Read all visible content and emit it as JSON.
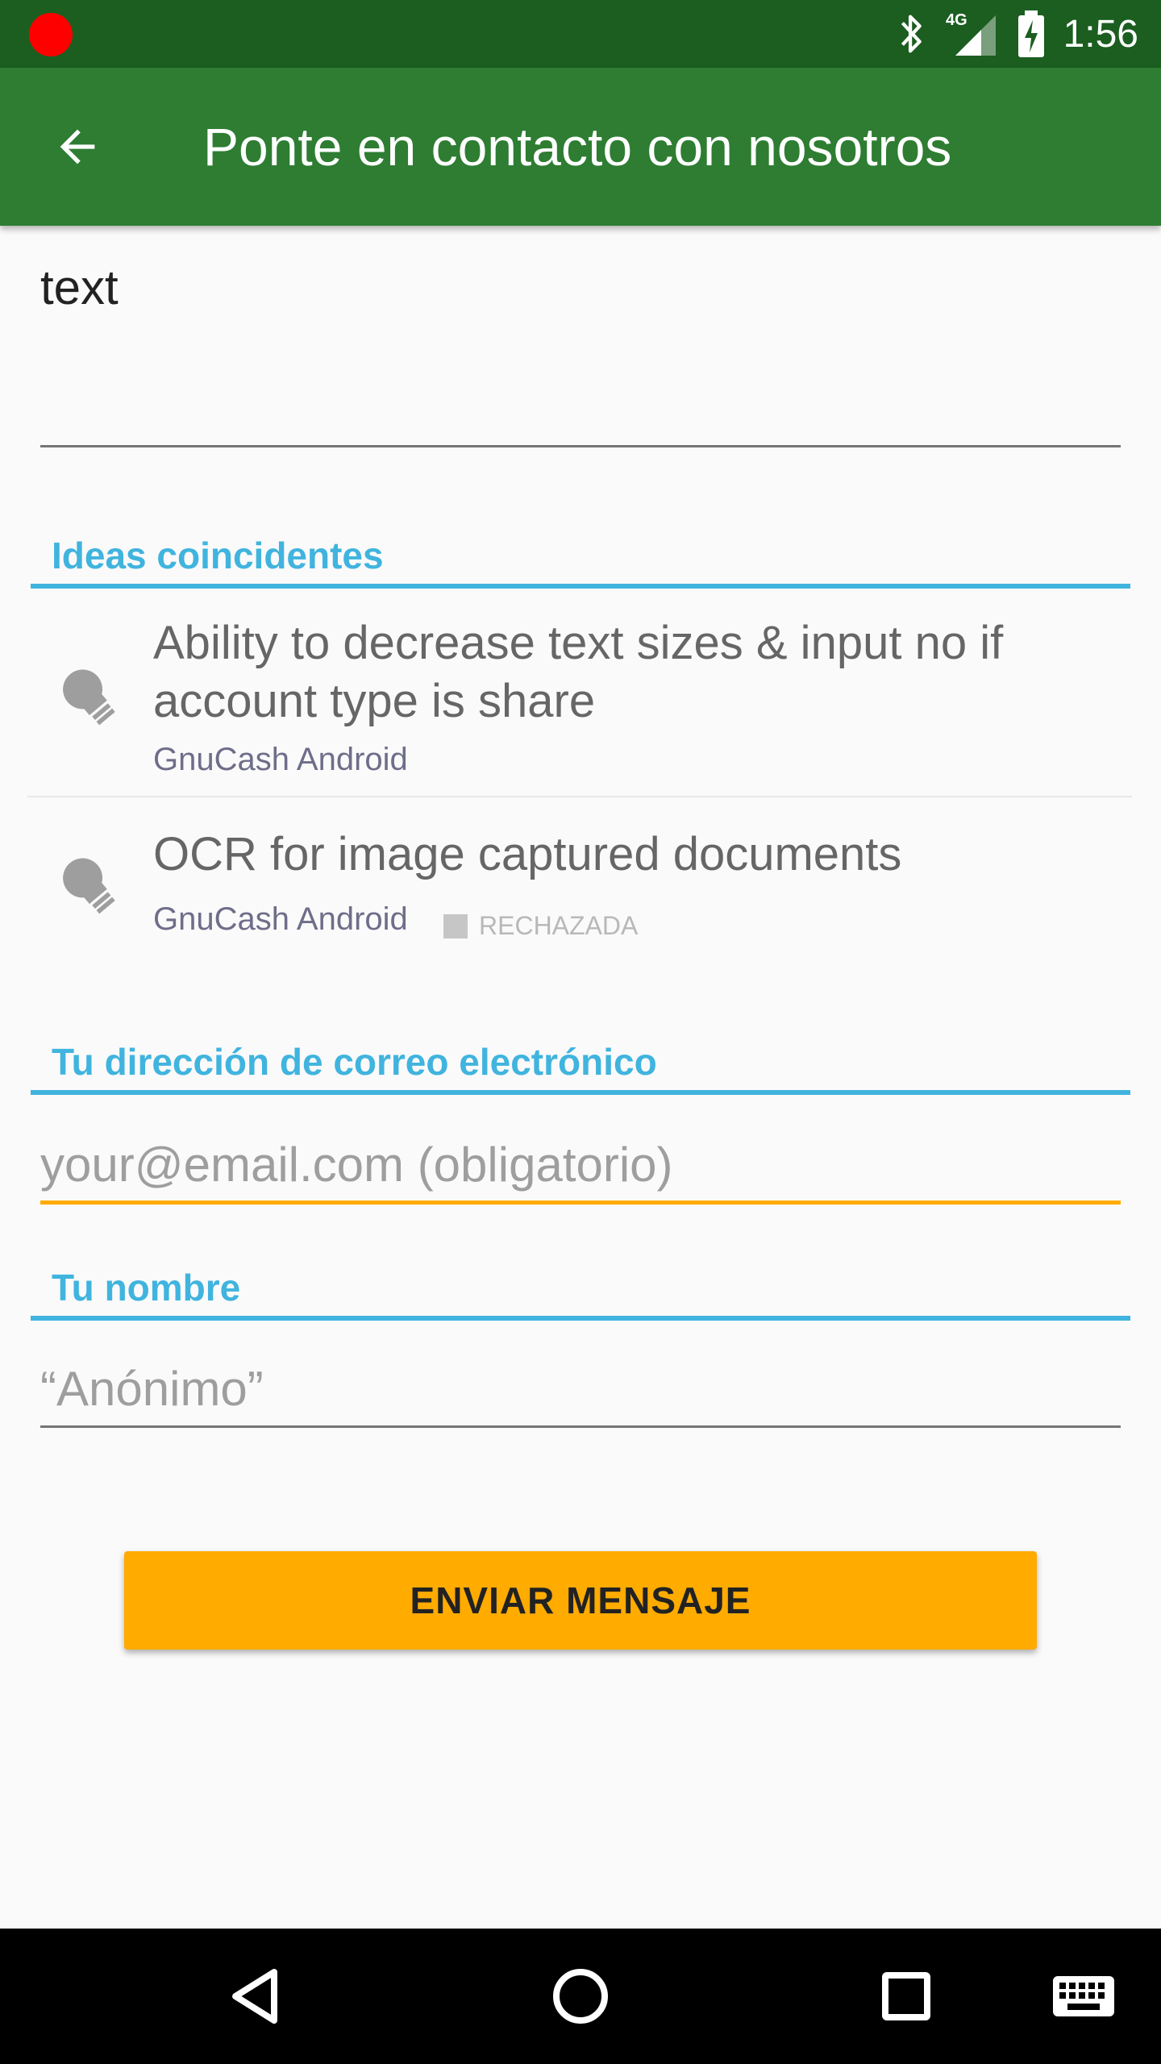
{
  "status_bar": {
    "time": "1:56",
    "network": "4G",
    "icons": [
      "record-indicator",
      "bluetooth-icon",
      "signal-icon",
      "battery-charging-icon"
    ]
  },
  "app_bar": {
    "title": "Ponte en contacto con nosotros",
    "back_icon": "arrow-left-icon"
  },
  "message": {
    "value": "text"
  },
  "ideas_section": {
    "heading": "Ideas coincidentes",
    "items": [
      {
        "title": "Ability to decrease text sizes & input no if account type is share",
        "forum": "GnuCash Android",
        "icon": "lightbulb-icon"
      },
      {
        "title": "OCR for image captured documents",
        "forum": "GnuCash Android",
        "status": "RECHAZADA",
        "icon": "lightbulb-icon"
      }
    ]
  },
  "email_section": {
    "heading": "Tu dirección de correo electrónico",
    "placeholder": "your@email.com (obligatorio)"
  },
  "name_section": {
    "heading": "Tu nombre",
    "placeholder": "“Anónimo”"
  },
  "send_button": {
    "label": "ENVIAR MENSAJE"
  },
  "nav_bar": {
    "icons": [
      "nav-back-icon",
      "nav-home-icon",
      "nav-recents-icon",
      "keyboard-icon"
    ]
  },
  "colors": {
    "status_bar": "#1b5e20",
    "app_bar": "#2e7d32",
    "section_accent": "#40b4de",
    "focused_field": "#ffab00",
    "button": "#ffab00"
  }
}
